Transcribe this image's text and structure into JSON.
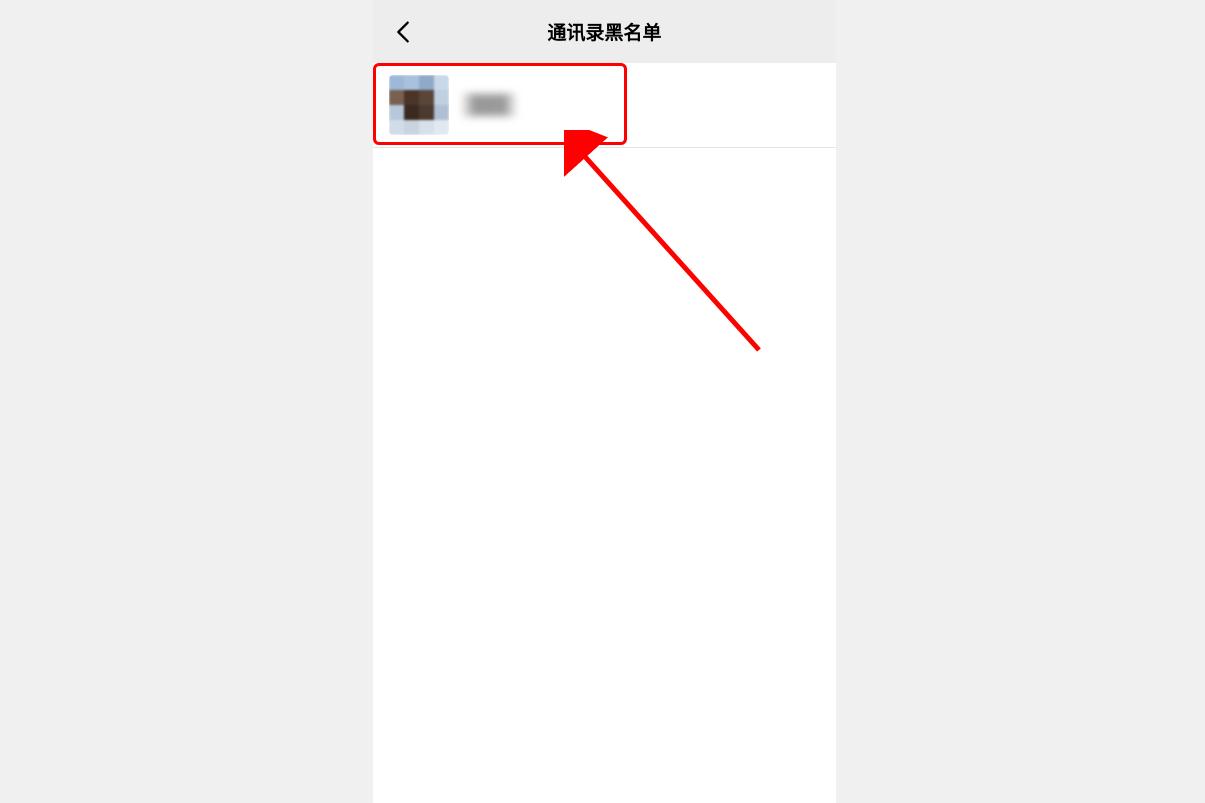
{
  "header": {
    "title": "通讯录黑名单",
    "back_icon": "chevron-left"
  },
  "list": {
    "items": [
      {
        "name": "███",
        "avatar_colors": [
          "#9db8d8",
          "#a8c1dd",
          "#8fa9c8",
          "#c8d8e8",
          "#7a6050",
          "#4a3528",
          "#5a4538",
          "#c0d0e0",
          "#b8c8dc",
          "#3a2a20",
          "#4a3a30",
          "#b0c0d4",
          "#d0dce8",
          "#c8d4e0",
          "#d8e0ea",
          "#e0e8f0"
        ]
      }
    ]
  },
  "annotation": {
    "highlight_color": "#ff0000"
  }
}
